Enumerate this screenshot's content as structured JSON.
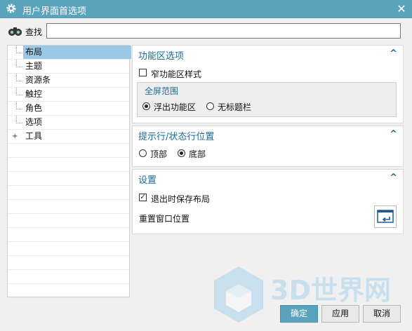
{
  "window": {
    "title": "用户界面首选项"
  },
  "search": {
    "label": "查找",
    "value": ""
  },
  "tree": {
    "items": [
      {
        "label": "布局"
      },
      {
        "label": "主题"
      },
      {
        "label": "资源条"
      },
      {
        "label": "触控"
      },
      {
        "label": "角色"
      },
      {
        "label": "选项"
      },
      {
        "label": "工具"
      }
    ]
  },
  "ribbon_section": {
    "title": "功能区选项",
    "narrow_label": "窄功能区样式",
    "narrow_checked": false,
    "fullscreen": {
      "title": "全屏范围",
      "option1": "浮出功能区",
      "option2": "无标题栏",
      "selected": "浮出功能区"
    }
  },
  "statusline_section": {
    "title": "提示行/状态行位置",
    "option_top": "顶部",
    "option_bottom": "底部",
    "selected": "底部"
  },
  "settings_section": {
    "title": "设置",
    "save_on_exit_label": "退出时保存布局",
    "save_on_exit_checked": true,
    "reset_label": "重置窗口位置"
  },
  "watermark": {
    "text": "3D世界网"
  },
  "buttons": {
    "ok": "确定",
    "apply": "应用",
    "cancel": "取消"
  },
  "colors": {
    "title_bar": "#5aa3bd",
    "section_heading": "#1c6b92",
    "selection": "#9bc8e5"
  }
}
